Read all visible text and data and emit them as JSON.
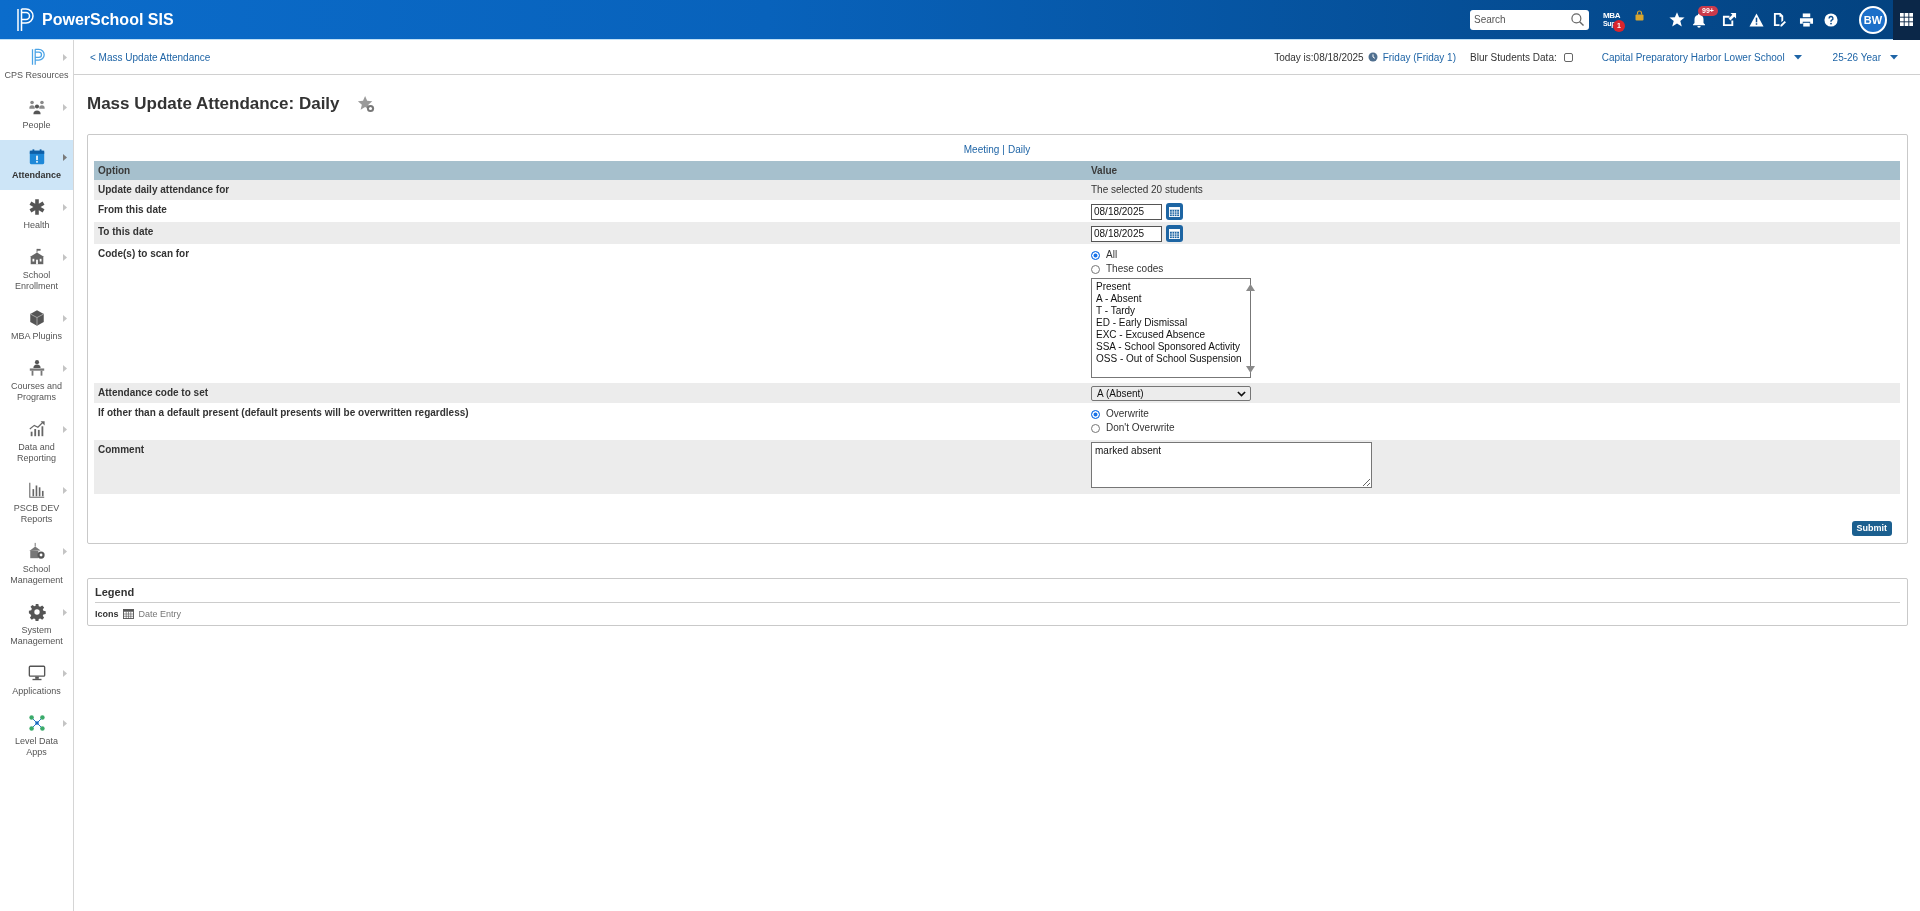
{
  "header": {
    "product_name": "PowerSchool SIS",
    "search": {
      "placeholder": "Search"
    },
    "plugin_logo": {
      "lines": [
        "MBA",
        "Sup"
      ],
      "badge": "1"
    },
    "notifications_badge": "99+",
    "avatar_initials": "BW"
  },
  "sidebar": {
    "items": [
      {
        "label": "CPS Resources",
        "selected": false
      },
      {
        "label": "People",
        "selected": false
      },
      {
        "label": "Attendance",
        "selected": true
      },
      {
        "label": "Health",
        "selected": false
      },
      {
        "label": "School Enrollment",
        "selected": false
      },
      {
        "label": "MBA Plugins",
        "selected": false
      },
      {
        "label": "Courses and Programs",
        "selected": false
      },
      {
        "label": "Data and Reporting",
        "selected": false
      },
      {
        "label": "PSCB DEV Reports",
        "selected": false
      },
      {
        "label": "School Management",
        "selected": false
      },
      {
        "label": "System Management",
        "selected": false
      },
      {
        "label": "Applications",
        "selected": false
      },
      {
        "label": "Level Data Apps",
        "selected": false
      }
    ]
  },
  "subheader": {
    "breadcrumb": "< Mass Update Attendance",
    "today": "Today is:08/18/2025",
    "day_link": "Friday (Friday 1)",
    "blur_label": "Blur Students Data:",
    "blur_checked": false,
    "school": "Capital Preparatory Harbor Lower School",
    "year": "25-26 Year"
  },
  "page_title": "Mass Update Attendance: Daily",
  "form": {
    "mode_links": [
      "Meeting",
      "Daily"
    ],
    "separator": "|",
    "columns": [
      "Option",
      "Value"
    ],
    "rows": [
      {
        "label": "Update daily attendance for",
        "kind": "text",
        "value": "The selected 20 students"
      },
      {
        "label": "From this date",
        "kind": "date",
        "value": "08/18/2025"
      },
      {
        "label": "To this date",
        "kind": "date",
        "value": "08/18/2025"
      },
      {
        "label": "Code(s) to scan for",
        "kind": "radio",
        "options": [
          {
            "label": "All",
            "selected": true
          },
          {
            "label": "These codes",
            "selected": false
          }
        ],
        "listbox": [
          "Present",
          "A - Absent",
          "T - Tardy",
          "ED - Early Dismissal",
          "EXC - Excused Absence",
          "SSA - School Sponsored Activity",
          "OSS - Out of School Suspension"
        ]
      },
      {
        "label": "Attendance code to set",
        "kind": "select",
        "value": "A (Absent)"
      },
      {
        "label": "If other than a default present (default presents will be overwritten regardless)",
        "kind": "radio",
        "options": [
          {
            "label": "Overwrite",
            "selected": true
          },
          {
            "label": "Don't Overwrite",
            "selected": false
          }
        ]
      },
      {
        "label": "Comment",
        "kind": "textarea",
        "value": "marked absent"
      }
    ],
    "submit": "Submit"
  },
  "legend": {
    "title": "Legend",
    "label": "Icons",
    "entries": [
      "Date Entry"
    ]
  }
}
